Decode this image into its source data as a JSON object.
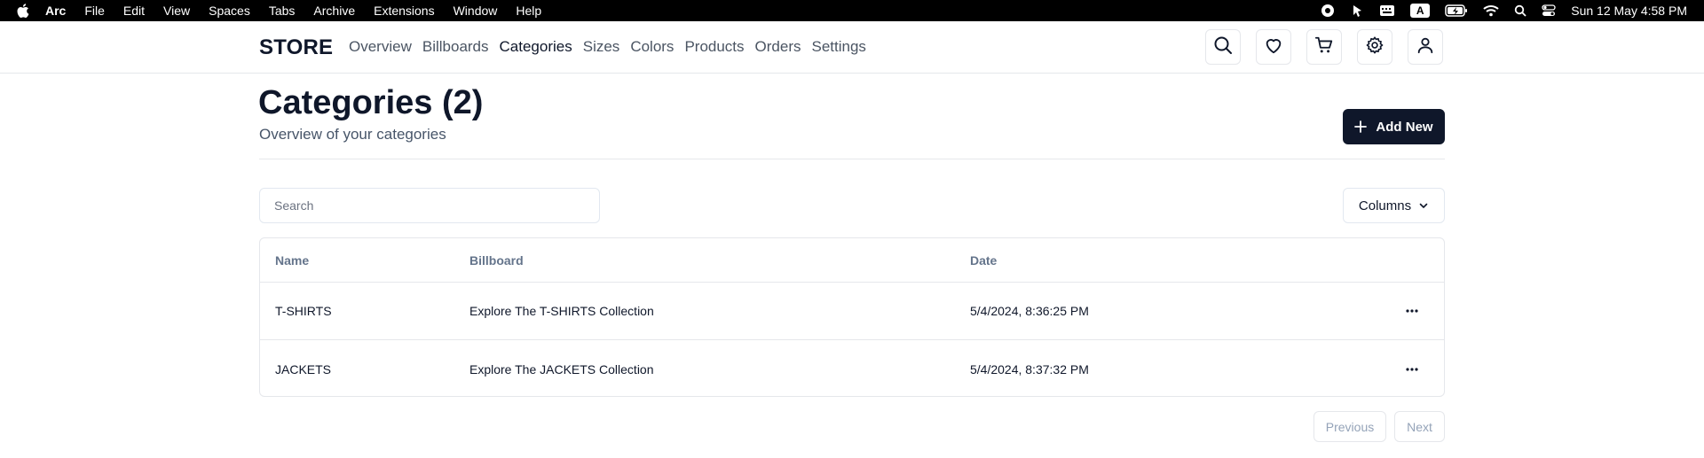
{
  "menubar": {
    "items": [
      "Arc",
      "File",
      "Edit",
      "View",
      "Spaces",
      "Tabs",
      "Archive",
      "Extensions",
      "Window",
      "Help"
    ],
    "input_indicator": "A",
    "clock": "Sun 12 May  4:58 PM"
  },
  "header": {
    "brand": "STORE",
    "nav": [
      "Overview",
      "Billboards",
      "Categories",
      "Sizes",
      "Colors",
      "Products",
      "Orders",
      "Settings"
    ],
    "active_nav": "Categories"
  },
  "page": {
    "title": "Categories (2)",
    "subtitle": "Overview of your categories",
    "add_button": "Add New",
    "search_placeholder": "Search",
    "columns_button": "Columns"
  },
  "table": {
    "headers": [
      "Name",
      "Billboard",
      "Date"
    ],
    "rows": [
      {
        "name": "T-SHIRTS",
        "billboard": "Explore The T-SHIRTS Collection",
        "date": "5/4/2024, 8:36:25 PM"
      },
      {
        "name": "JACKETS",
        "billboard": "Explore The JACKETS Collection",
        "date": "5/4/2024, 8:37:32 PM"
      }
    ]
  },
  "pagination": {
    "previous": "Previous",
    "next": "Next"
  },
  "colors": {
    "primary": "#0f172a",
    "border": "#e5e7eb",
    "muted": "#64748b"
  },
  "icons": [
    "apple-icon",
    "record-icon",
    "cursor-icon",
    "keyboard-icon",
    "battery-icon",
    "wifi-icon",
    "spotlight-icon",
    "control-center-icon",
    "search-icon",
    "heart-icon",
    "cart-icon",
    "gear-icon",
    "user-icon",
    "plus-icon",
    "chevron-down-icon",
    "more-horizontal-icon"
  ]
}
